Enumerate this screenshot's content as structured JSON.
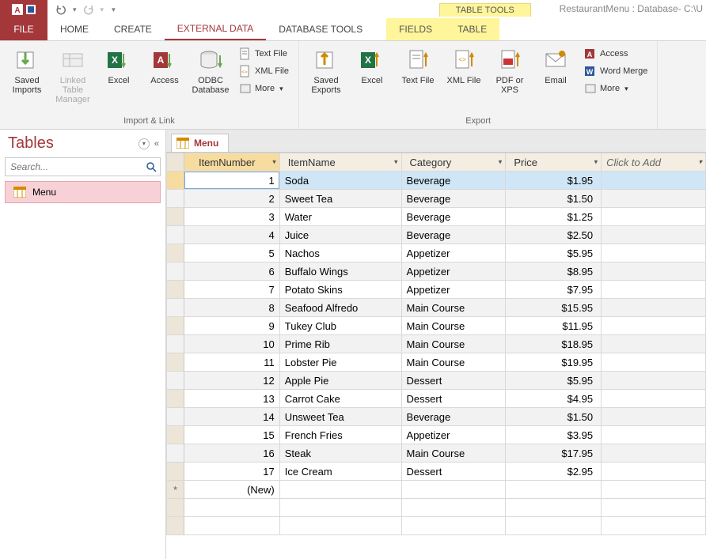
{
  "app": {
    "doc_title": "RestaurantMenu : Database- C:\\U",
    "context_header": "TABLE TOOLS"
  },
  "tabs": {
    "file": "FILE",
    "items": [
      "HOME",
      "CREATE",
      "EXTERNAL DATA",
      "DATABASE TOOLS"
    ],
    "context": [
      "FIELDS",
      "TABLE"
    ],
    "active_index": 2
  },
  "ribbon": {
    "group1": {
      "label": "Import & Link",
      "saved_imports": "Saved Imports",
      "linked_table_manager": "Linked Table Manager",
      "excel": "Excel",
      "access": "Access",
      "odbc": "ODBC Database",
      "text_file": "Text File",
      "xml_file": "XML File",
      "more": "More"
    },
    "group2": {
      "label": "Export",
      "saved_exports": "Saved Exports",
      "excel": "Excel",
      "text_file": "Text File",
      "xml_file": "XML File",
      "pdf_xps": "PDF or XPS",
      "email": "Email",
      "access": "Access",
      "word_merge": "Word Merge",
      "more": "More"
    }
  },
  "nav": {
    "title": "Tables",
    "search_placeholder": "Search...",
    "items": [
      {
        "label": "Menu"
      }
    ]
  },
  "doc": {
    "tab_label": "Menu",
    "columns": [
      "ItemNumber",
      "ItemName",
      "Category",
      "Price"
    ],
    "click_to_add": "Click to Add",
    "new_row_label": "(New)",
    "rows": [
      {
        "n": "1",
        "name": "Soda",
        "cat": "Beverage",
        "price": "$1.95"
      },
      {
        "n": "2",
        "name": "Sweet Tea",
        "cat": "Beverage",
        "price": "$1.50"
      },
      {
        "n": "3",
        "name": "Water",
        "cat": "Beverage",
        "price": "$1.25"
      },
      {
        "n": "4",
        "name": "Juice",
        "cat": "Beverage",
        "price": "$2.50"
      },
      {
        "n": "5",
        "name": "Nachos",
        "cat": "Appetizer",
        "price": "$5.95"
      },
      {
        "n": "6",
        "name": "Buffalo Wings",
        "cat": "Appetizer",
        "price": "$8.95"
      },
      {
        "n": "7",
        "name": "Potato Skins",
        "cat": "Appetizer",
        "price": "$7.95"
      },
      {
        "n": "8",
        "name": "Seafood Alfredo",
        "cat": "Main Course",
        "price": "$15.95"
      },
      {
        "n": "9",
        "name": "Tukey Club",
        "cat": "Main Course",
        "price": "$11.95"
      },
      {
        "n": "10",
        "name": "Prime Rib",
        "cat": "Main Course",
        "price": "$18.95"
      },
      {
        "n": "11",
        "name": "Lobster Pie",
        "cat": "Main Course",
        "price": "$19.95"
      },
      {
        "n": "12",
        "name": "Apple Pie",
        "cat": "Dessert",
        "price": "$5.95"
      },
      {
        "n": "13",
        "name": "Carrot Cake",
        "cat": "Dessert",
        "price": "$4.95"
      },
      {
        "n": "14",
        "name": "Unsweet Tea",
        "cat": "Beverage",
        "price": "$1.50"
      },
      {
        "n": "15",
        "name": "French Fries",
        "cat": "Appetizer",
        "price": "$3.95"
      },
      {
        "n": "16",
        "name": "Steak",
        "cat": "Main Course",
        "price": "$17.95"
      },
      {
        "n": "17",
        "name": "Ice Cream",
        "cat": "Dessert",
        "price": "$2.95"
      }
    ],
    "selected_row": 0
  }
}
